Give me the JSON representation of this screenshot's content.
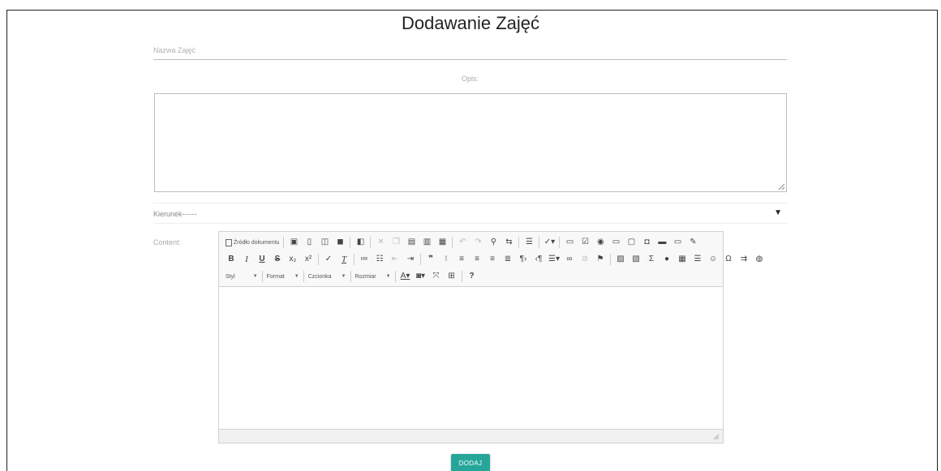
{
  "page": {
    "title": "Dodawanie Zajęć"
  },
  "form": {
    "name_placeholder": "Nazwa Zajęć",
    "opis_label": "Opis:",
    "opis_value": "",
    "select_value": "Kierunek------",
    "content_label": "Content:",
    "submit_label": "DODAJ"
  },
  "editor": {
    "source_label": "Źródło dokumentu",
    "styl_label": "Styl",
    "format_label": "Format",
    "czcionka_label": "Czcionka",
    "rozmiar_label": "Rozmiar",
    "help_glyph": "?"
  },
  "colors": {
    "accent": "#26a69a",
    "border": "#bdbdbd",
    "toolbar_bg": "#f8f8f8"
  }
}
